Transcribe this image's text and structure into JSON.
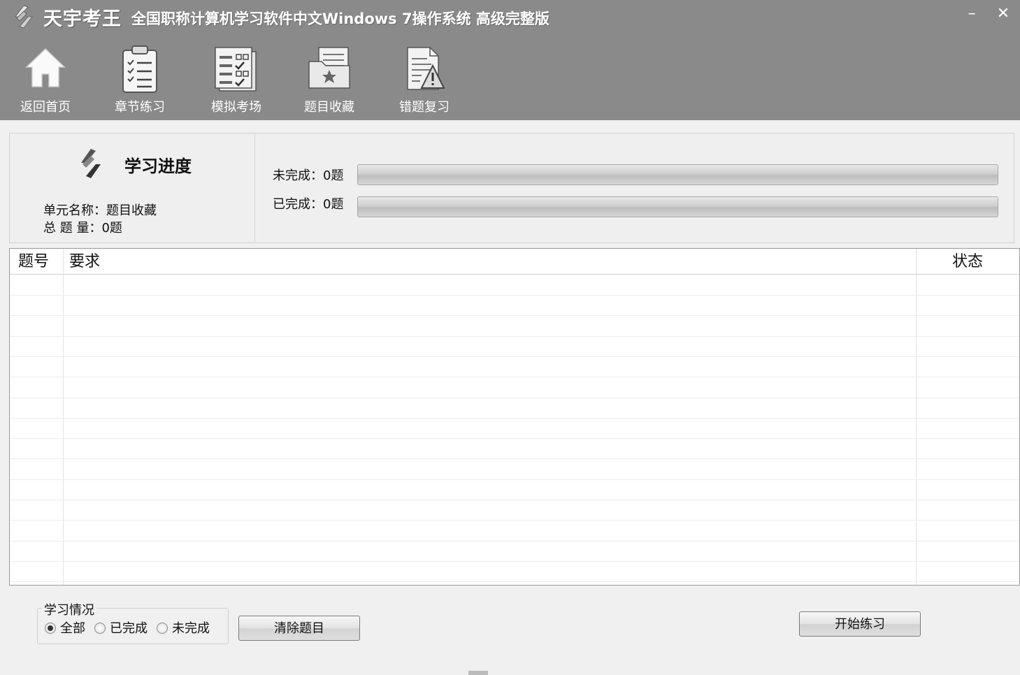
{
  "titlebar": {
    "brand": "天宇考王",
    "title": "全国职称计算机学习软件中文Windows 7操作系统 高级完整版",
    "minimize": "–",
    "close": "✕"
  },
  "nav": [
    {
      "label": "返回首页",
      "icon": "home-icon"
    },
    {
      "label": "章节练习",
      "icon": "clipboard-checklist-icon"
    },
    {
      "label": "模拟考场",
      "icon": "exam-sheet-icon"
    },
    {
      "label": "题目收藏",
      "icon": "favorite-folder-icon"
    },
    {
      "label": "错题复习",
      "icon": "warning-document-icon"
    }
  ],
  "progress": {
    "title": "学习进度",
    "unit_line": "单元名称：题目收藏",
    "total_line": "总 题 量：0题",
    "incomplete_label": "未完成：0题",
    "complete_label": "已完成：0题",
    "incomplete_fraction": 0,
    "complete_fraction": 0
  },
  "table": {
    "columns": [
      "题号",
      "要求",
      "状态"
    ],
    "rows": []
  },
  "filter": {
    "group_title": "学习情况",
    "options": [
      "全部",
      "已完成",
      "未完成"
    ],
    "selected": "全部"
  },
  "buttons": {
    "clear": "清除题目",
    "start": "开始练习"
  },
  "colors": {
    "header_band": "#8a8a8a",
    "window_bg": "#f0f0f0"
  }
}
